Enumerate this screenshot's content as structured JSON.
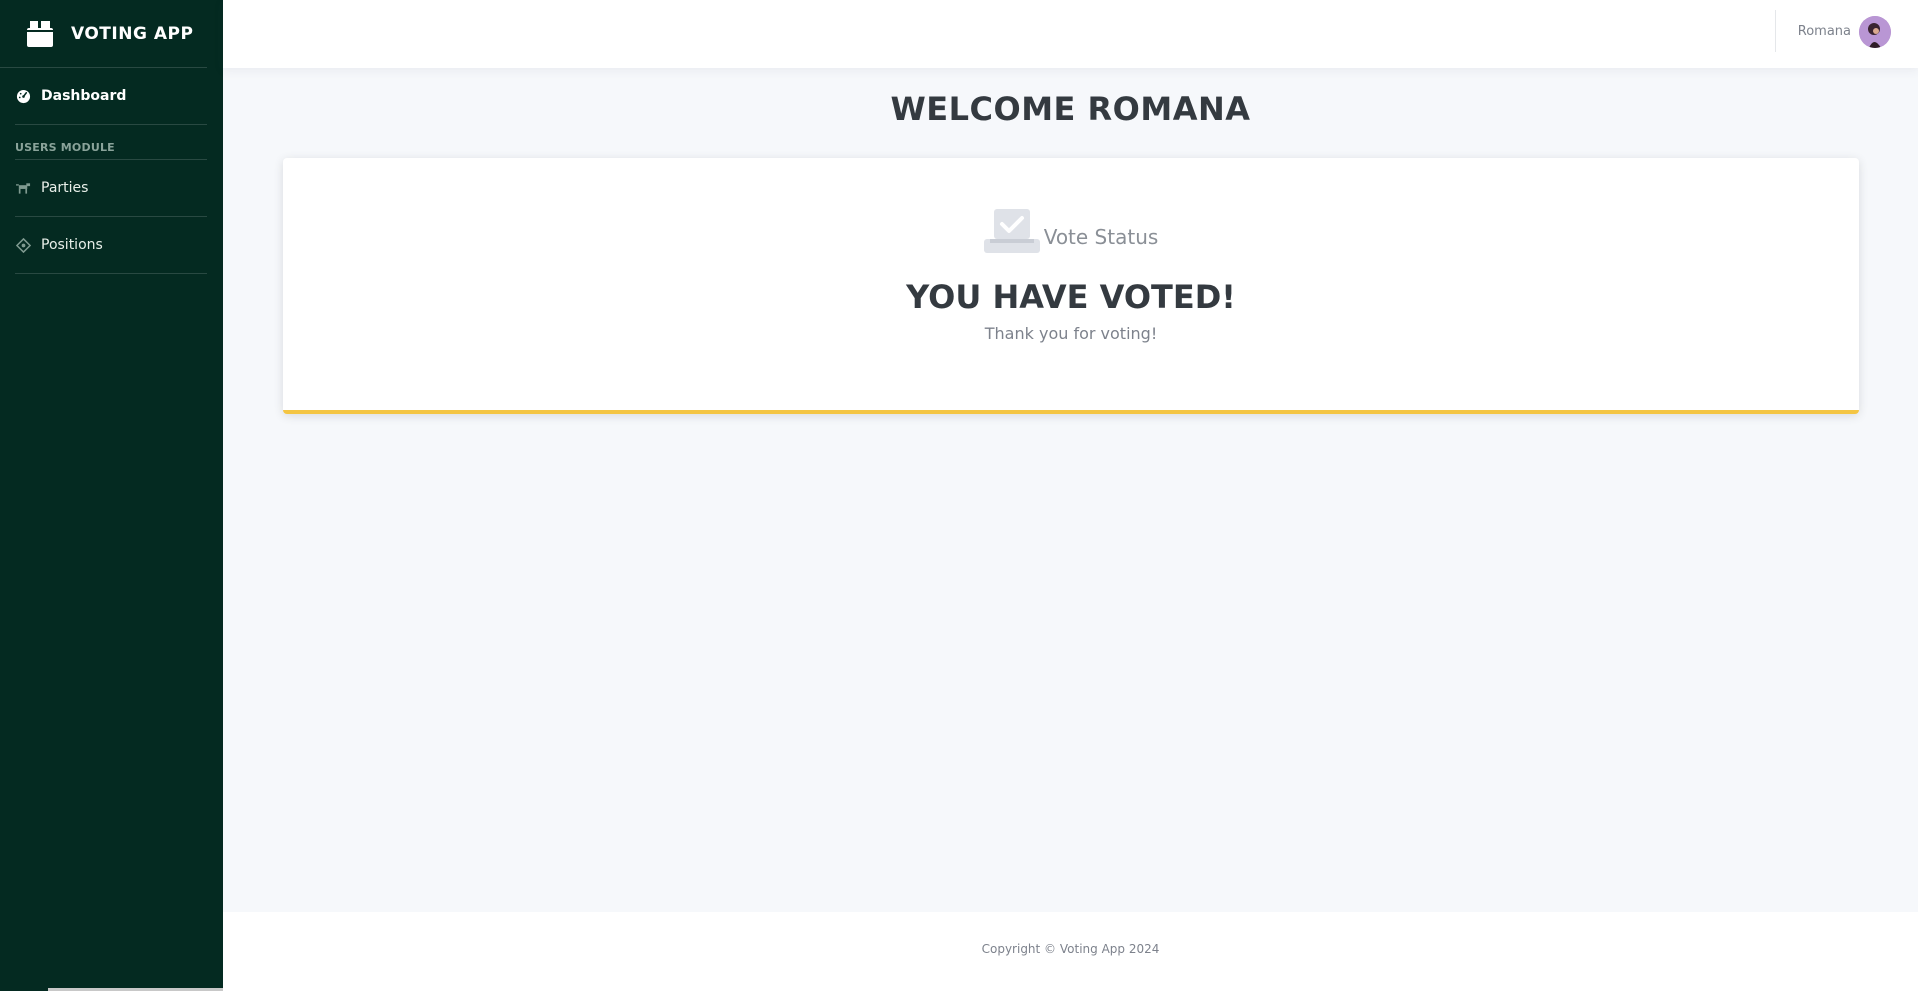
{
  "app": {
    "brand": "VOTING APP",
    "brand_icon": "ballot-box-icon"
  },
  "sidebar": {
    "items": [
      {
        "label": "Dashboard",
        "icon": "gauge-icon",
        "active": true
      }
    ],
    "section_label": "USERS MODULE",
    "module_items": [
      {
        "label": "Parties",
        "icon": "party-animal-icon"
      },
      {
        "label": "Positions",
        "icon": "target-icon"
      }
    ]
  },
  "topbar": {
    "user_name": "Romana",
    "avatar": "user-avatar"
  },
  "main": {
    "welcome": "WELCOME ROMANA",
    "card": {
      "status_label": "Vote Status",
      "status_icon": "checked-ballot-icon",
      "title": "YOU HAVE VOTED!",
      "subtitle": "Thank you for voting!",
      "accent_color": "#f4c543"
    }
  },
  "footer": {
    "copyright": "Copyright © Voting App 2024"
  },
  "colors": {
    "sidebar_bg": "#042a21",
    "page_bg": "#f6f8fb"
  }
}
